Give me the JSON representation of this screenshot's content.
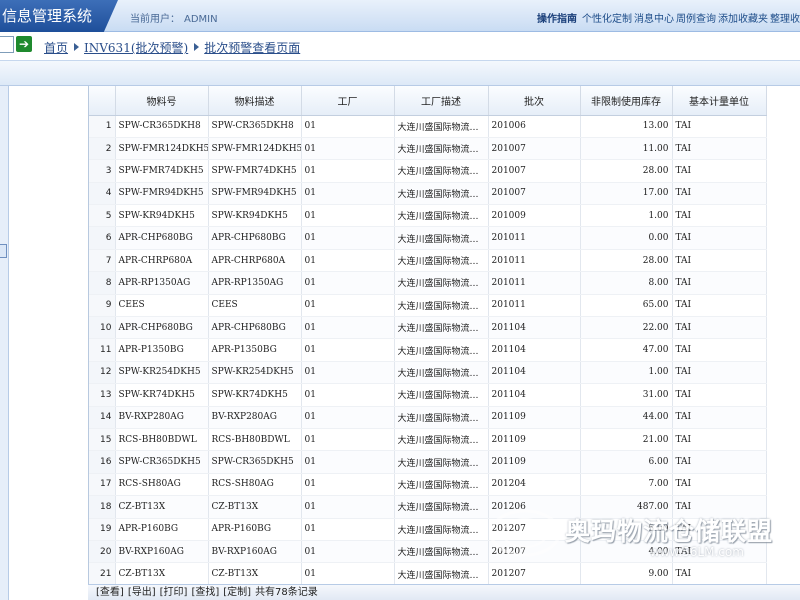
{
  "app": {
    "title": "信息管理系统"
  },
  "header": {
    "user_label": "当前用户：",
    "user_name": "ADMIN",
    "links_title": "操作指南",
    "links": [
      "个性化定制",
      "消息中心",
      "周例查询",
      "添加收藏夹",
      "整理收"
    ]
  },
  "breadcrumb": {
    "items": [
      "首页",
      "INV631(批次预警)",
      "批次预警查看页面"
    ]
  },
  "grid": {
    "columns": [
      "物料号",
      "物料描述",
      "工厂",
      "工厂描述",
      "批次",
      "非限制使用库存",
      "基本计量单位"
    ],
    "rows": [
      [
        "1",
        "SPW-CR365DKH8",
        "SPW-CR365DKH8",
        "01",
        "大连川盛国际物流…",
        "201006",
        "13.00",
        "TAI"
      ],
      [
        "2",
        "SPW-FMR124DKH5",
        "SPW-FMR124DKH5",
        "01",
        "大连川盛国际物流…",
        "201007",
        "11.00",
        "TAI"
      ],
      [
        "3",
        "SPW-FMR74DKH5",
        "SPW-FMR74DKH5",
        "01",
        "大连川盛国际物流…",
        "201007",
        "28.00",
        "TAI"
      ],
      [
        "4",
        "SPW-FMR94DKH5",
        "SPW-FMR94DKH5",
        "01",
        "大连川盛国际物流…",
        "201007",
        "17.00",
        "TAI"
      ],
      [
        "5",
        "SPW-KR94DKH5",
        "SPW-KR94DKH5",
        "01",
        "大连川盛国际物流…",
        "201009",
        "1.00",
        "TAI"
      ],
      [
        "6",
        "APR-CHP680BG",
        "APR-CHP680BG",
        "01",
        "大连川盛国际物流…",
        "201011",
        "0.00",
        "TAI"
      ],
      [
        "7",
        "APR-CHRP680A",
        "APR-CHRP680A",
        "01",
        "大连川盛国际物流…",
        "201011",
        "28.00",
        "TAI"
      ],
      [
        "8",
        "APR-RP1350AG",
        "APR-RP1350AG",
        "01",
        "大连川盛国际物流…",
        "201011",
        "8.00",
        "TAI"
      ],
      [
        "9",
        "CEES",
        "CEES",
        "01",
        "大连川盛国际物流…",
        "201011",
        "65.00",
        "TAI"
      ],
      [
        "10",
        "APR-CHP680BG",
        "APR-CHP680BG",
        "01",
        "大连川盛国际物流…",
        "201104",
        "22.00",
        "TAI"
      ],
      [
        "11",
        "APR-P1350BG",
        "APR-P1350BG",
        "01",
        "大连川盛国际物流…",
        "201104",
        "47.00",
        "TAI"
      ],
      [
        "12",
        "SPW-KR254DKH5",
        "SPW-KR254DKH5",
        "01",
        "大连川盛国际物流…",
        "201104",
        "1.00",
        "TAI"
      ],
      [
        "13",
        "SPW-KR74DKH5",
        "SPW-KR74DKH5",
        "01",
        "大连川盛国际物流…",
        "201104",
        "31.00",
        "TAI"
      ],
      [
        "14",
        "BV-RXP280AG",
        "BV-RXP280AG",
        "01",
        "大连川盛国际物流…",
        "201109",
        "44.00",
        "TAI"
      ],
      [
        "15",
        "RCS-BH80BDWL",
        "RCS-BH80BDWL",
        "01",
        "大连川盛国际物流…",
        "201109",
        "21.00",
        "TAI"
      ],
      [
        "16",
        "SPW-CR365DKH5",
        "SPW-CR365DKH5",
        "01",
        "大连川盛国际物流…",
        "201109",
        "6.00",
        "TAI"
      ],
      [
        "17",
        "RCS-SH80AG",
        "RCS-SH80AG",
        "01",
        "大连川盛国际物流…",
        "201204",
        "7.00",
        "TAI"
      ],
      [
        "18",
        "CZ-BT13X",
        "CZ-BT13X",
        "01",
        "大连川盛国际物流…",
        "201206",
        "487.00",
        "TAI"
      ],
      [
        "19",
        "APR-P160BG",
        "APR-P160BG",
        "01",
        "大连川盛国际物流…",
        "201207",
        "5.00",
        "TAI"
      ],
      [
        "20",
        "BV-RXP160AG",
        "BV-RXP160AG",
        "01",
        "大连川盛国际物流…",
        "201207",
        "4.00",
        "TAI"
      ],
      [
        "21",
        "CZ-BT13X",
        "CZ-BT13X",
        "01",
        "大连川盛国际物流…",
        "201207",
        "9.00",
        "TAI"
      ]
    ]
  },
  "toolbar": {
    "buttons": [
      "[查看]",
      "[导出]",
      "[打印]",
      "[查找]",
      "[定制]"
    ],
    "total_text": "共有78条记录"
  },
  "watermark": {
    "text": "奥玛物流仓储联盟",
    "url": "www.56LM.com"
  }
}
